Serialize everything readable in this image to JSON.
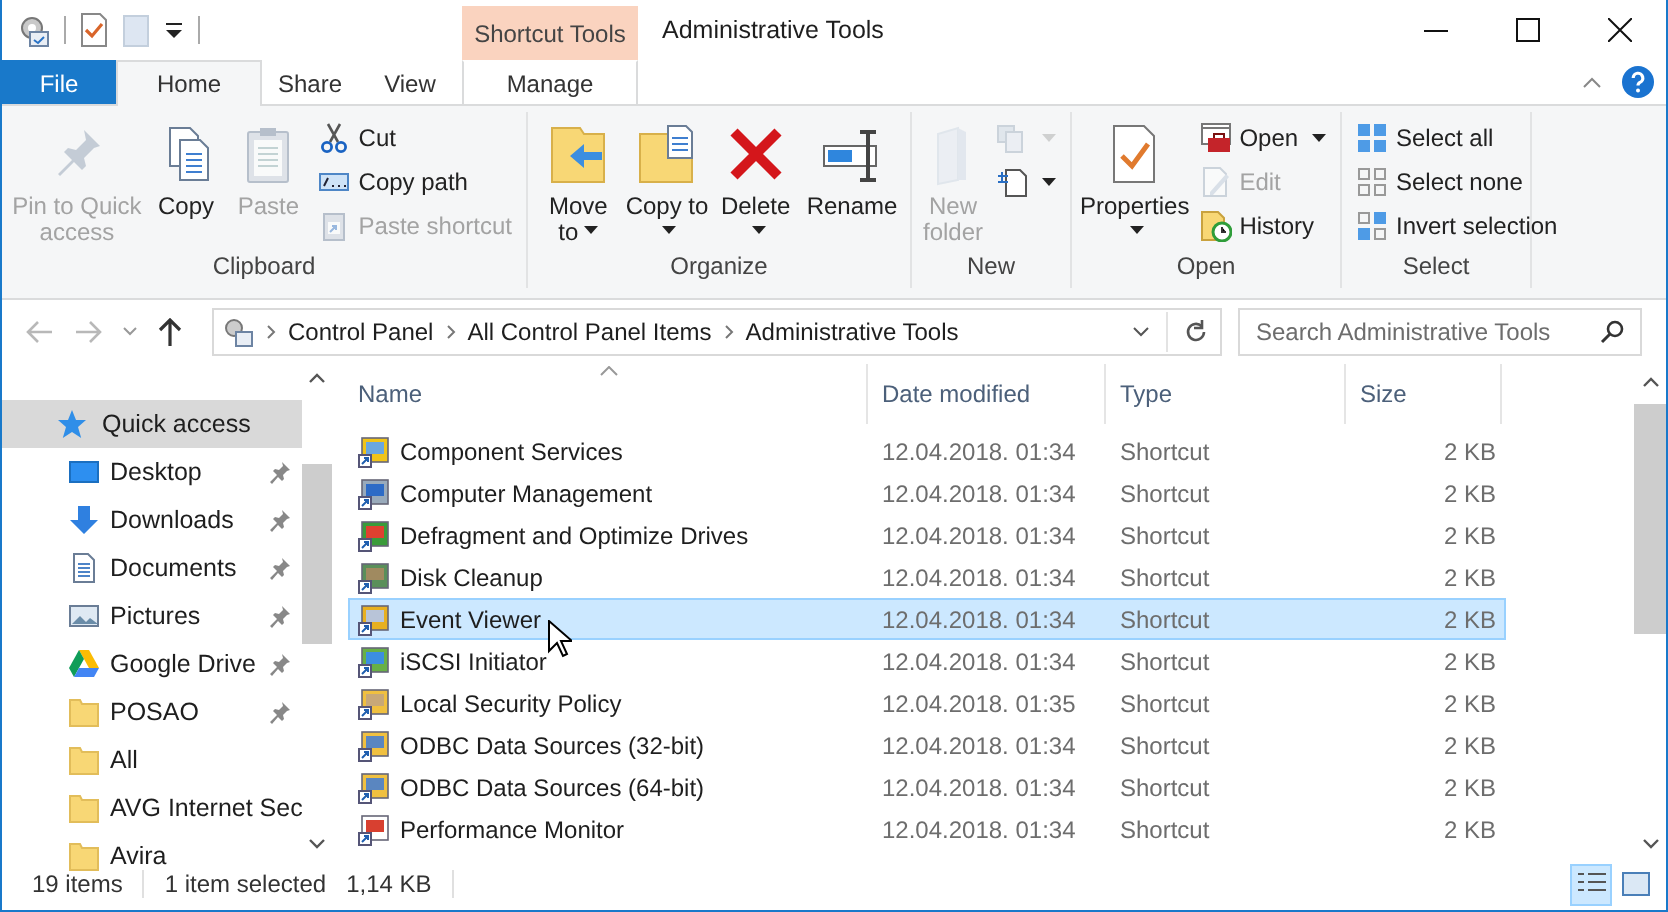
{
  "window": {
    "title": "Administrative Tools"
  },
  "context_tab": {
    "label": "Shortcut Tools"
  },
  "tabs": [
    {
      "label": "File",
      "kind": "file",
      "selected": false
    },
    {
      "label": "Home",
      "kind": "normal",
      "selected": true
    },
    {
      "label": "Share",
      "kind": "normal",
      "selected": false
    },
    {
      "label": "View",
      "kind": "normal",
      "selected": false
    },
    {
      "label": "Manage",
      "kind": "contextual",
      "selected": false
    }
  ],
  "ribbon": {
    "groups": [
      {
        "label": "Clipboard",
        "items": [
          {
            "kind": "large",
            "label": "Pin to Quick access",
            "disabled": true,
            "caret": false
          },
          {
            "kind": "large",
            "label": "Copy",
            "disabled": false,
            "caret": false
          },
          {
            "kind": "large",
            "label": "Paste",
            "disabled": true,
            "caret": false
          },
          {
            "kind": "small",
            "label": "Cut",
            "disabled": false,
            "caret": false
          },
          {
            "kind": "small",
            "label": "Copy path",
            "disabled": false,
            "caret": false
          },
          {
            "kind": "small",
            "label": "Paste shortcut",
            "disabled": true,
            "caret": false
          }
        ]
      },
      {
        "label": "Organize",
        "items": [
          {
            "kind": "large",
            "label": "Move to",
            "disabled": false,
            "caret": true
          },
          {
            "kind": "large",
            "label": "Copy to",
            "disabled": false,
            "caret": true
          },
          {
            "kind": "large",
            "label": "Delete",
            "disabled": false,
            "caret": true
          },
          {
            "kind": "large",
            "label": "Rename",
            "disabled": false,
            "caret": false
          }
        ]
      },
      {
        "label": "New",
        "items": [
          {
            "kind": "large",
            "label": "New folder",
            "disabled": true,
            "caret": false
          },
          {
            "kind": "icon",
            "disabled": true,
            "caret": true
          },
          {
            "kind": "icon",
            "disabled": false,
            "caret": true
          }
        ]
      },
      {
        "label": "Open",
        "items": [
          {
            "kind": "large",
            "label": "Properties",
            "disabled": false,
            "caret": true
          },
          {
            "kind": "small",
            "label": "Open",
            "disabled": false,
            "caret": true
          },
          {
            "kind": "small",
            "label": "Edit",
            "disabled": true,
            "caret": false
          },
          {
            "kind": "small",
            "label": "History",
            "disabled": false,
            "caret": false
          }
        ]
      },
      {
        "label": "Select",
        "items": [
          {
            "kind": "small",
            "label": "Select all",
            "disabled": false,
            "caret": false
          },
          {
            "kind": "small",
            "label": "Select none",
            "disabled": false,
            "caret": false
          },
          {
            "kind": "small",
            "label": "Invert selection",
            "disabled": false,
            "caret": false
          }
        ]
      }
    ]
  },
  "address_bar": {
    "crumbs": [
      "Control Panel",
      "All Control Panel Items",
      "Administrative Tools"
    ]
  },
  "search": {
    "placeholder": "Search Administrative Tools"
  },
  "sidebar": {
    "items": [
      {
        "label": "Quick access",
        "kind": "root",
        "selected": true,
        "pinned": false
      },
      {
        "label": "Desktop",
        "kind": "item",
        "selected": false,
        "pinned": true
      },
      {
        "label": "Downloads",
        "kind": "item",
        "selected": false,
        "pinned": true
      },
      {
        "label": "Documents",
        "kind": "item",
        "selected": false,
        "pinned": true
      },
      {
        "label": "Pictures",
        "kind": "item",
        "selected": false,
        "pinned": true
      },
      {
        "label": "Google Drive",
        "kind": "item",
        "selected": false,
        "pinned": true
      },
      {
        "label": "POSAO",
        "kind": "item",
        "selected": false,
        "pinned": true
      },
      {
        "label": "All",
        "kind": "item",
        "selected": false,
        "pinned": false
      },
      {
        "label": "AVG Internet Sec",
        "kind": "item",
        "selected": false,
        "pinned": false
      },
      {
        "label": "Avira",
        "kind": "item",
        "selected": false,
        "pinned": false
      }
    ]
  },
  "file_list": {
    "columns": [
      {
        "label": "Name",
        "sorted": true
      },
      {
        "label": "Date modified",
        "sorted": false
      },
      {
        "label": "Type",
        "sorted": false
      },
      {
        "label": "Size",
        "sorted": false
      }
    ],
    "rows": [
      {
        "name": "Component Services",
        "date": "12.04.2018. 01:34",
        "type": "Shortcut",
        "size": "2 KB",
        "selected": false
      },
      {
        "name": "Computer Management",
        "date": "12.04.2018. 01:34",
        "type": "Shortcut",
        "size": "2 KB",
        "selected": false
      },
      {
        "name": "Defragment and Optimize Drives",
        "date": "12.04.2018. 01:34",
        "type": "Shortcut",
        "size": "2 KB",
        "selected": false
      },
      {
        "name": "Disk Cleanup",
        "date": "12.04.2018. 01:34",
        "type": "Shortcut",
        "size": "2 KB",
        "selected": false
      },
      {
        "name": "Event Viewer",
        "date": "12.04.2018. 01:34",
        "type": "Shortcut",
        "size": "2 KB",
        "selected": true
      },
      {
        "name": "iSCSI Initiator",
        "date": "12.04.2018. 01:34",
        "type": "Shortcut",
        "size": "2 KB",
        "selected": false
      },
      {
        "name": "Local Security Policy",
        "date": "12.04.2018. 01:35",
        "type": "Shortcut",
        "size": "2 KB",
        "selected": false
      },
      {
        "name": "ODBC Data Sources (32-bit)",
        "date": "12.04.2018. 01:34",
        "type": "Shortcut",
        "size": "2 KB",
        "selected": false
      },
      {
        "name": "ODBC Data Sources (64-bit)",
        "date": "12.04.2018. 01:34",
        "type": "Shortcut",
        "size": "2 KB",
        "selected": false
      },
      {
        "name": "Performance Monitor",
        "date": "12.04.2018. 01:34",
        "type": "Shortcut",
        "size": "2 KB",
        "selected": false
      }
    ]
  },
  "status_bar": {
    "item_count": "19 items",
    "selection": "1 item selected",
    "selection_size": "1,14 KB"
  },
  "view_buttons": [
    {
      "kind": "details",
      "selected": true
    },
    {
      "kind": "large-icons",
      "selected": false
    }
  ]
}
